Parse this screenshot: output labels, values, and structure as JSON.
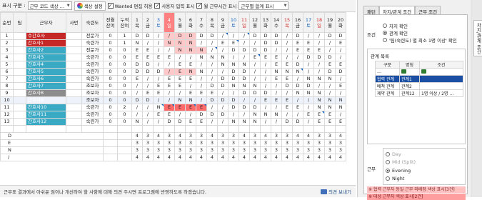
{
  "toolbar": {
    "display_label": "표시 구분 :",
    "display_select": "근무 코드 색상 …",
    "color_settings": "색상 설정",
    "cb1": {
      "checked": true,
      "label": "Wanted 편집 허용"
    },
    "cb2": {
      "checked": true,
      "label": "사용자 입력 표시"
    },
    "cb3": {
      "checked": true,
      "label": "월 근무시간 표시"
    },
    "total_select": "근무별 합계 표시"
  },
  "grid": {
    "headers": [
      "순번",
      "팀",
      "근무자",
      "사번",
      "숙련도",
      "전월\n잔여",
      "누적\n잔여"
    ],
    "days": [
      {
        "n": "1",
        "w": "목",
        "c": ""
      },
      {
        "n": "2",
        "w": "금",
        "c": ""
      },
      {
        "n": "3",
        "w": "토",
        "c": "sat"
      },
      {
        "n": "4",
        "w": "일",
        "c": "sun hl"
      },
      {
        "n": "5",
        "w": "월",
        "c": ""
      },
      {
        "n": "6",
        "w": "화",
        "c": ""
      },
      {
        "n": "7",
        "w": "수",
        "c": ""
      },
      {
        "n": "8",
        "w": "목",
        "c": ""
      },
      {
        "n": "9",
        "w": "금",
        "c": ""
      },
      {
        "n": "10",
        "w": "토",
        "c": "sat"
      },
      {
        "n": "11",
        "w": "일",
        "c": "sun"
      },
      {
        "n": "12",
        "w": "월",
        "c": ""
      },
      {
        "n": "13",
        "w": "화",
        "c": ""
      },
      {
        "n": "14",
        "w": "수",
        "c": ""
      },
      {
        "n": "15",
        "w": "목",
        "c": "sun"
      },
      {
        "n": "16",
        "w": "금",
        "c": ""
      },
      {
        "n": "17",
        "w": "토",
        "c": "sat"
      },
      {
        "n": "18",
        "w": "일",
        "c": "sun"
      },
      {
        "n": "19",
        "w": "월",
        "c": ""
      },
      {
        "n": "20",
        "w": "화",
        "c": ""
      }
    ],
    "rows": [
      {
        "seq": "1",
        "team": "",
        "name": "수간호사",
        "nc": "nm-red",
        "emp": "",
        "skill": "전문가",
        "prev": "0",
        "cum": "1",
        "cells": [
          "D",
          "D",
          "/",
          "/",
          "D",
          "D",
          "D",
          "D",
          "/",
          "/",
          "/",
          "D",
          "D",
          "D",
          "/",
          "D",
          "/",
          "/",
          "D",
          "D"
        ],
        "pk": [
          3,
          4,
          5
        ],
        "pr": []
      },
      {
        "seq": "2",
        "team": "",
        "name": "간호사1",
        "nc": "nm-red",
        "emp": "",
        "skill": "숙련가",
        "prev": "0",
        "cum": "1",
        "cells": [
          "N",
          "/",
          "/",
          "N",
          "N",
          "N",
          "/",
          "/",
          "E",
          "E",
          "/",
          "/",
          "D",
          "D",
          "/",
          "E",
          "E",
          "/",
          "/",
          "E"
        ],
        "pk": [
          3,
          4,
          5
        ],
        "pr": []
      },
      {
        "seq": "3",
        "team": "",
        "name": "간호사2",
        "nc": "nm-teal",
        "emp": "",
        "skill": "전문가",
        "prev": "0",
        "cum": "0",
        "cells": [
          "E",
          "E",
          "/",
          "/",
          "N",
          "N",
          "N",
          "/",
          "/",
          "D",
          "D",
          "D",
          "D",
          "/",
          "/",
          "E",
          "E",
          "E",
          "/",
          "/"
        ],
        "pk": [
          4,
          5,
          6
        ],
        "pr": []
      },
      {
        "seq": "4",
        "team": "",
        "name": "간호사3",
        "nc": "nm-teal",
        "emp": "",
        "skill": "숙련가",
        "prev": "0",
        "cum": "0",
        "cells": [
          "E",
          "E",
          "E",
          "E",
          "/",
          "/",
          "N",
          "N",
          "N",
          "/",
          "/",
          "E",
          "E",
          "E",
          "/",
          "/",
          "D",
          "D",
          "D",
          "/"
        ],
        "pk": [],
        "pr": []
      },
      {
        "seq": "5",
        "team": "",
        "name": "간호사4",
        "nc": "nm-teal",
        "emp": "",
        "skill": "숙련가",
        "prev": "0",
        "cum": "0",
        "cells": [
          "D",
          "D",
          "/",
          "/",
          "E",
          "E",
          "/",
          "/",
          "N",
          "N",
          "N",
          "/",
          "/",
          "E",
          "E",
          "D",
          "/",
          "/",
          "E",
          "E"
        ],
        "pk": [],
        "pr": []
      },
      {
        "seq": "6",
        "team": "",
        "name": "간호사5",
        "nc": "nm-teal",
        "emp": "",
        "skill": "숙련가",
        "prev": "0",
        "cum": "0",
        "cells": [
          "D",
          "D",
          "D",
          "/",
          "E",
          "N",
          "N",
          "/",
          "/",
          "D",
          "D",
          "/",
          "/",
          "N",
          "N",
          "N",
          "/",
          "/",
          "D",
          "D"
        ],
        "pk": [
          3,
          4,
          5
        ],
        "pr": []
      },
      {
        "seq": "7",
        "team": "",
        "name": "간호사6",
        "nc": "nm-teal",
        "emp": "",
        "skill": "숙련가",
        "prev": "0",
        "cum": "0",
        "cells": [
          "E",
          "/",
          "/",
          "E",
          "E",
          "E",
          "/",
          "/",
          "D",
          "D",
          "D",
          "/",
          "/",
          "E",
          "E",
          "/",
          "N",
          "N",
          "N",
          "/"
        ],
        "pk": [],
        "pr": []
      },
      {
        "seq": "8",
        "team": "",
        "name": "간호사7",
        "nc": "nm-teal",
        "emp": "",
        "skill": "조보자",
        "prev": "0",
        "cum": "0",
        "cells": [
          "/",
          "/",
          "E",
          "E",
          "E",
          "/",
          "/",
          "D",
          "D",
          "N",
          "N",
          "N",
          "/",
          "/",
          "D",
          "D",
          "D",
          "/",
          "/",
          "E"
        ],
        "pk": [],
        "pr": []
      },
      {
        "seq": "9",
        "team": "",
        "name": "간호사8",
        "nc": "nm-gray",
        "emp": "",
        "skill": "조보자",
        "prev": "0",
        "cum": "0",
        "cells": [
          "/",
          "E",
          "E",
          "/",
          "/",
          "E",
          "E",
          "E",
          "/",
          "/",
          "D",
          "D",
          "D",
          "/",
          "/",
          "N",
          "N",
          "N",
          "/",
          "/"
        ],
        "pk": [],
        "pr": []
      },
      {
        "seq": "10",
        "team": "",
        "name": "간호사9",
        "nc": "nm-gray",
        "emp": "",
        "skill": "조보자",
        "prev": "0",
        "cum": "0",
        "cells": [
          "D",
          "D",
          "/",
          "/",
          "N",
          "N",
          "/",
          "D",
          "D",
          "D",
          "/",
          "/",
          "E",
          "E",
          "E",
          "/",
          "/",
          "N",
          "N",
          "N"
        ],
        "pk": [],
        "pr": []
      },
      {
        "seq": "11",
        "team": "",
        "name": "간호사10",
        "nc": "nm-teal",
        "emp": "",
        "skill": "숙련가",
        "prev": "0",
        "cum": "2",
        "cells": [
          "/",
          "/",
          "N",
          "E",
          "E",
          "E",
          "E",
          "/",
          "/",
          "D",
          "D",
          "D",
          "/",
          "/",
          "E",
          "E",
          "/",
          "N",
          "N",
          "N"
        ],
        "pk": [],
        "pr": [
          3,
          4,
          5,
          6
        ]
      },
      {
        "seq": "12",
        "team": "",
        "name": "간호사11",
        "nc": "nm-teal",
        "emp": "",
        "skill": "숙련가",
        "prev": "0",
        "cum": "0",
        "cells": [
          "/",
          "/",
          "E",
          "E",
          "/",
          "/",
          "D",
          "D",
          "D",
          "/",
          "/",
          "N",
          "N",
          "N",
          "/",
          "/",
          "E",
          "E",
          "E",
          "/"
        ],
        "pk": [],
        "pr": []
      },
      {
        "seq": "13",
        "team": "",
        "name": "간호사12",
        "nc": "nm-teal",
        "emp": "",
        "skill": "숙련가",
        "prev": "0",
        "cum": "0",
        "cells": [
          "N",
          "/",
          "/",
          "D",
          "D",
          "E",
          "E",
          "/",
          "/",
          "N",
          "N",
          "N",
          "/",
          "/",
          "D",
          "D",
          "/",
          "E",
          "E",
          "E"
        ],
        "pk": [],
        "pr": []
      }
    ],
    "summary": [
      {
        "label": "D",
        "vals": [
          "4",
          "3",
          "4",
          "3",
          "4",
          "3",
          "3",
          "4",
          "3",
          "3",
          "4",
          "3",
          "4",
          "3",
          "3",
          "4",
          "4",
          "3",
          "3",
          "4"
        ]
      },
      {
        "label": "E",
        "vals": [
          "3",
          "3",
          "3",
          "3",
          "3",
          "3",
          "3",
          "3",
          "3",
          "3",
          "3",
          "3",
          "3",
          "3",
          "3",
          "3",
          "3",
          "3",
          "3",
          "3"
        ]
      },
      {
        "label": "N",
        "vals": [
          "3",
          "3",
          "3",
          "3",
          "3",
          "3",
          "3",
          "3",
          "3",
          "3",
          "3",
          "3",
          "3",
          "3",
          "3",
          "3",
          "3",
          "3",
          "3",
          "3"
        ]
      },
      {
        "label": "/",
        "vals": [
          "4",
          "4",
          "4",
          "4",
          "4",
          "4",
          "4",
          "4",
          "4",
          "4",
          "4",
          "4",
          "4",
          "4",
          "4",
          "4",
          "4",
          "4",
          "4",
          "4"
        ]
      }
    ]
  },
  "status": {
    "text": "근무표 결과에서 아쉬운 점이나 개선하여 할 사항에 대해 의견 주시면 프로그램에 반영하도록 하겠습니다.",
    "feedback": "의견 보내기"
  },
  "panel": {
    "tabs": [
      "패턴",
      "차지/관계 조건",
      "근무 조건"
    ],
    "condition_label": "조건",
    "condition_options": [
      "차지 확인",
      "관계 확인",
      "'팀(숙련도) 별 최소 1명 이상' 확인"
    ],
    "condition_selected": 1,
    "rel_title": "관계 목록",
    "rel_headers": [
      "구분",
      "명칭",
      "조건"
    ],
    "rel_rows": [
      {
        "type": "…",
        "name": "",
        "cond": "",
        "sel": false
      },
      {
        "type": "협력 관계",
        "name": "관계1",
        "cond": "",
        "sel": true
      },
      {
        "type": "배척 관계",
        "name": "관계2",
        "cond": "",
        "sel": false
      },
      {
        "type": "제약 관계",
        "name": "관계12",
        "cond": "1명 이상 / 2명 …",
        "sel": false
      }
    ],
    "gun_label": "근무",
    "gun_options": [
      "Day",
      "Mid (Split)",
      "Evening",
      "Night"
    ],
    "gun_selected": 2,
    "legend1": "※ 협력 근무자 동일 근무 미배정 색상 표시[3건]",
    "legend2": "※ 대상 근무자 색상 표시[2건]",
    "side_tab": "차지/관계 조건"
  }
}
